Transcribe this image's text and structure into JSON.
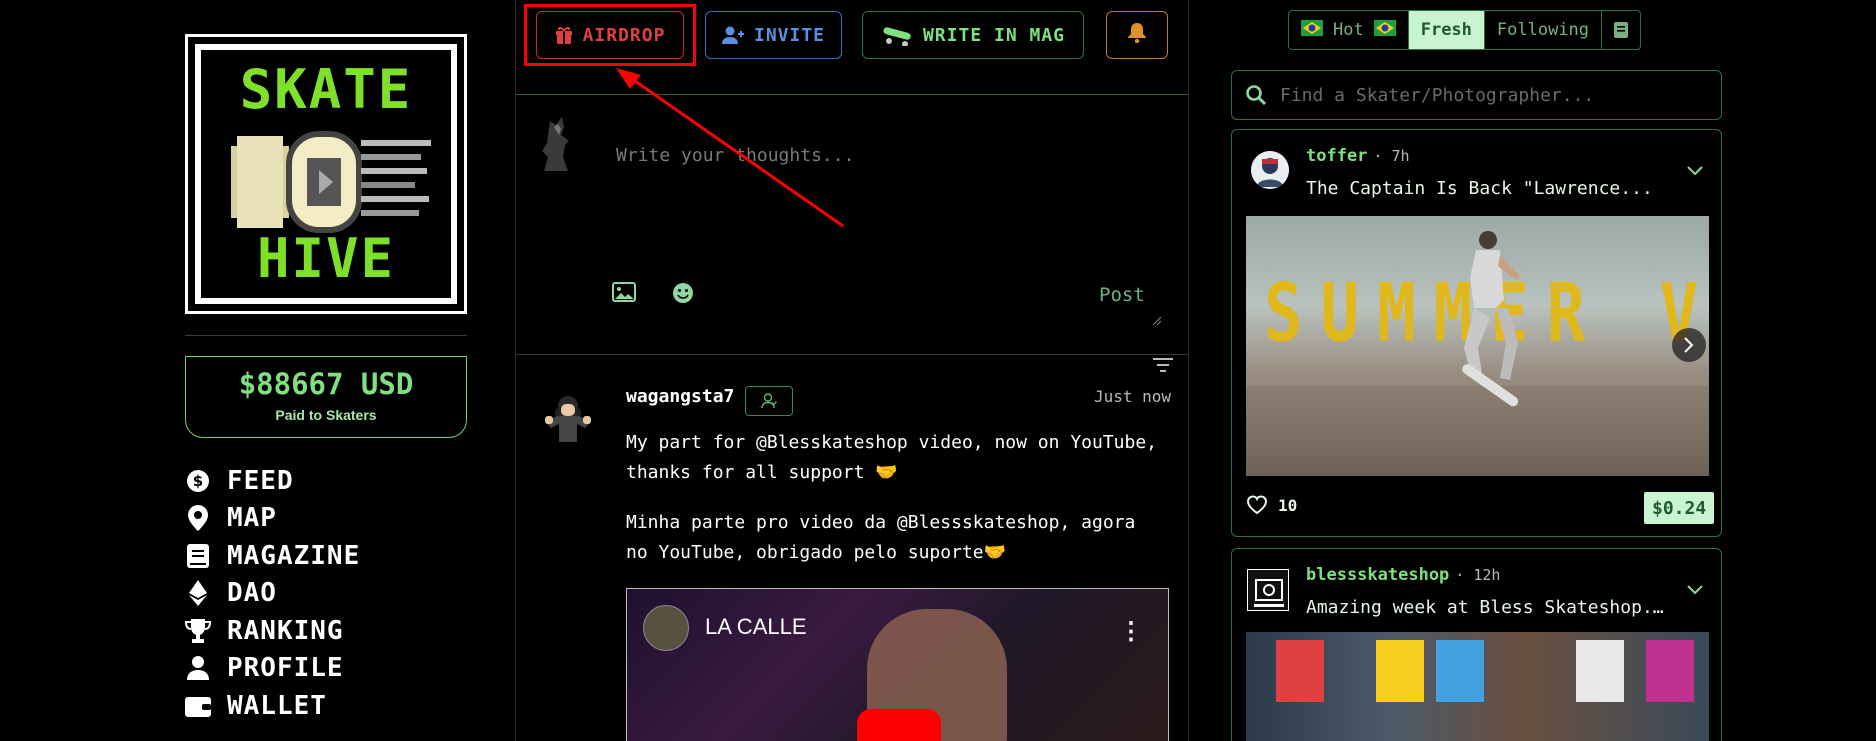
{
  "sidebar": {
    "logo": {
      "word_top": "SKATE",
      "word_bottom": "HIVE"
    },
    "paid": {
      "amount": "$88667 USD",
      "label": "Paid to Skaters"
    },
    "nav": [
      {
        "label": "FEED",
        "icon": "dollar-coin-icon"
      },
      {
        "label": "MAP",
        "icon": "map-pin-icon"
      },
      {
        "label": "MAGAZINE",
        "icon": "book-icon"
      },
      {
        "label": "DAO",
        "icon": "ethereum-icon"
      },
      {
        "label": "RANKING",
        "icon": "trophy-icon"
      },
      {
        "label": "PROFILE",
        "icon": "user-icon"
      },
      {
        "label": "WALLET",
        "icon": "wallet-icon"
      }
    ]
  },
  "topbar": {
    "airdrop_label": "AIRDROP",
    "invite_label": "INVITE",
    "mag_label": "WRITE IN MAG"
  },
  "composer": {
    "placeholder": "Write your thoughts...",
    "post_label": "Post"
  },
  "post": {
    "author": "wagangsta7",
    "time": "Just now",
    "text_en": "My part for @Blesskateshop video, now on YouTube, thanks for all support 🤝",
    "text_pt": "Minha parte pro video da @Blessskateshop, agora no YouTube, obrigado pelo suporte🤝",
    "video_title": "LA CALLE"
  },
  "right": {
    "tabs": [
      {
        "label": "Hot",
        "active": false
      },
      {
        "label": "Fresh",
        "active": true
      },
      {
        "label": "Following",
        "active": false
      }
    ],
    "search_placeholder": "Find a Skater/Photographer...",
    "cards": [
      {
        "author": "toffer",
        "time": "· 7h",
        "title": "The Captain Is Back \"Lawrence...",
        "image_text": "SUMMER VIBES",
        "likes": "10",
        "payout": "$0.24"
      },
      {
        "author": "blessskateshop",
        "time": "· 12h",
        "title": "Amazing week at Bless Skateshop..."
      }
    ]
  },
  "colors": {
    "accent_green": "#7ee07e",
    "airdrop_red": "#e04040",
    "invite_blue": "#5b8fe0",
    "bell_orange": "#e0902a",
    "annotation_red": "#ff0000"
  }
}
